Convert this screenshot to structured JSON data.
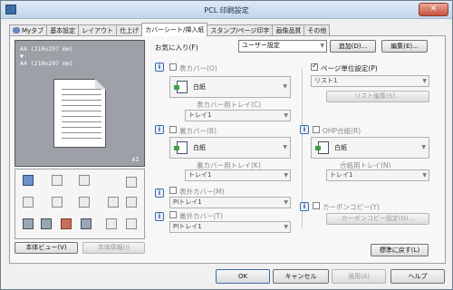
{
  "window": {
    "title": "PCL 印刷設定",
    "close": "✕"
  },
  "tabs": [
    {
      "label": "Myタブ"
    },
    {
      "label": "基本設定"
    },
    {
      "label": "レイアウト"
    },
    {
      "label": "仕上げ"
    },
    {
      "label": "カバーシート/挿入紙"
    },
    {
      "label": "スタンプ/ページ印字"
    },
    {
      "label": "画像品質"
    },
    {
      "label": "その他"
    }
  ],
  "favorites": {
    "label": "お気に入り(F)",
    "value": "ユーザー設定",
    "add": "追加(D)...",
    "edit": "編集(E)..."
  },
  "preview": {
    "line1": "A4 (210x297 mm)",
    "arrow": "▼",
    "line2": "A4 (210x297 mm)",
    "copies": "x1"
  },
  "left_buttons": {
    "view": "本体ビュー(V)",
    "info": "本体情報(I)"
  },
  "front_cover": {
    "label": "表カバー(O)",
    "paper": "白紙",
    "tray_label": "表カバー用トレイ(C)",
    "tray": "トレイ1"
  },
  "back_cover": {
    "label": "裏カバー(B)",
    "paper": "白紙",
    "tray_label": "裏カバー用トレイ(K)",
    "tray": "トレイ1"
  },
  "front_inner": {
    "label": "表外カバー(M)",
    "value": "PIトレイ1"
  },
  "back_inner": {
    "label": "裏外カバー(T)",
    "value": "PIトレイ1"
  },
  "page_setting": {
    "label": "ページ単位設定(P)",
    "value": "リスト1",
    "edit": "リスト編集(S)..."
  },
  "ohp": {
    "label": "OHP合紙(R)",
    "paper": "白紙",
    "tray_label": "合紙用トレイ(N)",
    "tray": "トレイ1"
  },
  "carbon": {
    "label": "カーボンコピー(Y)",
    "settings": "カーボンコピー設定(G)..."
  },
  "reset": "標準に戻す(L)",
  "footer": {
    "ok": "OK",
    "cancel": "キャンセル",
    "apply": "適用(A)",
    "help": "ヘルプ"
  },
  "colors": {
    "accent": "#3d6aa8",
    "titlebar": "#c4d5ea",
    "close": "#c7503a"
  }
}
